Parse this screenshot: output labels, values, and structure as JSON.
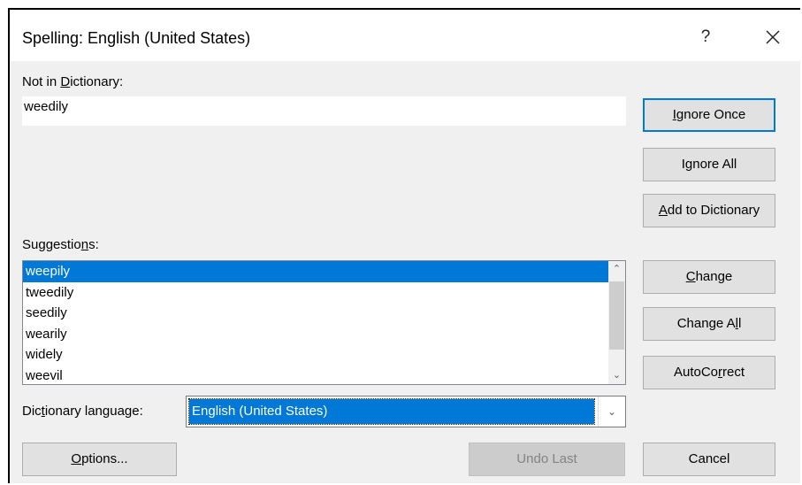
{
  "window": {
    "title": "Spelling: English (United States)",
    "help_label": "?",
    "close_icon": "close-icon"
  },
  "not_in_dictionary": {
    "label_pre": "Not in ",
    "label_key": "D",
    "label_post": "ictionary:",
    "value": "weedily"
  },
  "suggestions": {
    "label_pre": "Suggestio",
    "label_key": "n",
    "label_post": "s:",
    "items": [
      "weepily",
      "tweedily",
      "seedily",
      "wearily",
      "widely",
      "weevil"
    ],
    "selected_index": 0
  },
  "dictionary_language": {
    "label_pre": "Dic",
    "label_key": "t",
    "label_post": "ionary language:",
    "value": "English (United States)"
  },
  "buttons": {
    "ignore_once": {
      "pre": "",
      "key": "I",
      "post": "gnore Once"
    },
    "ignore_all": {
      "pre": "I",
      "key": "g",
      "post": "nore All"
    },
    "add_to_dictionary": {
      "pre": "",
      "key": "A",
      "post": "dd to Dictionary"
    },
    "change": {
      "pre": "",
      "key": "C",
      "post": "hange"
    },
    "change_all": {
      "pre": "Change A",
      "key": "l",
      "post": "l"
    },
    "autocorrect": {
      "pre": "AutoCo",
      "key": "r",
      "post": "rect"
    },
    "options": {
      "pre": "",
      "key": "O",
      "post": "ptions..."
    },
    "undo_last": {
      "pre": "",
      "key": "",
      "post": "Undo Last"
    },
    "cancel": {
      "pre": "",
      "key": "",
      "post": "Cancel"
    }
  },
  "colors": {
    "accent": "#0078d7",
    "dialog_bg": "#f0f0f0",
    "button_bg": "#e1e1e1"
  }
}
